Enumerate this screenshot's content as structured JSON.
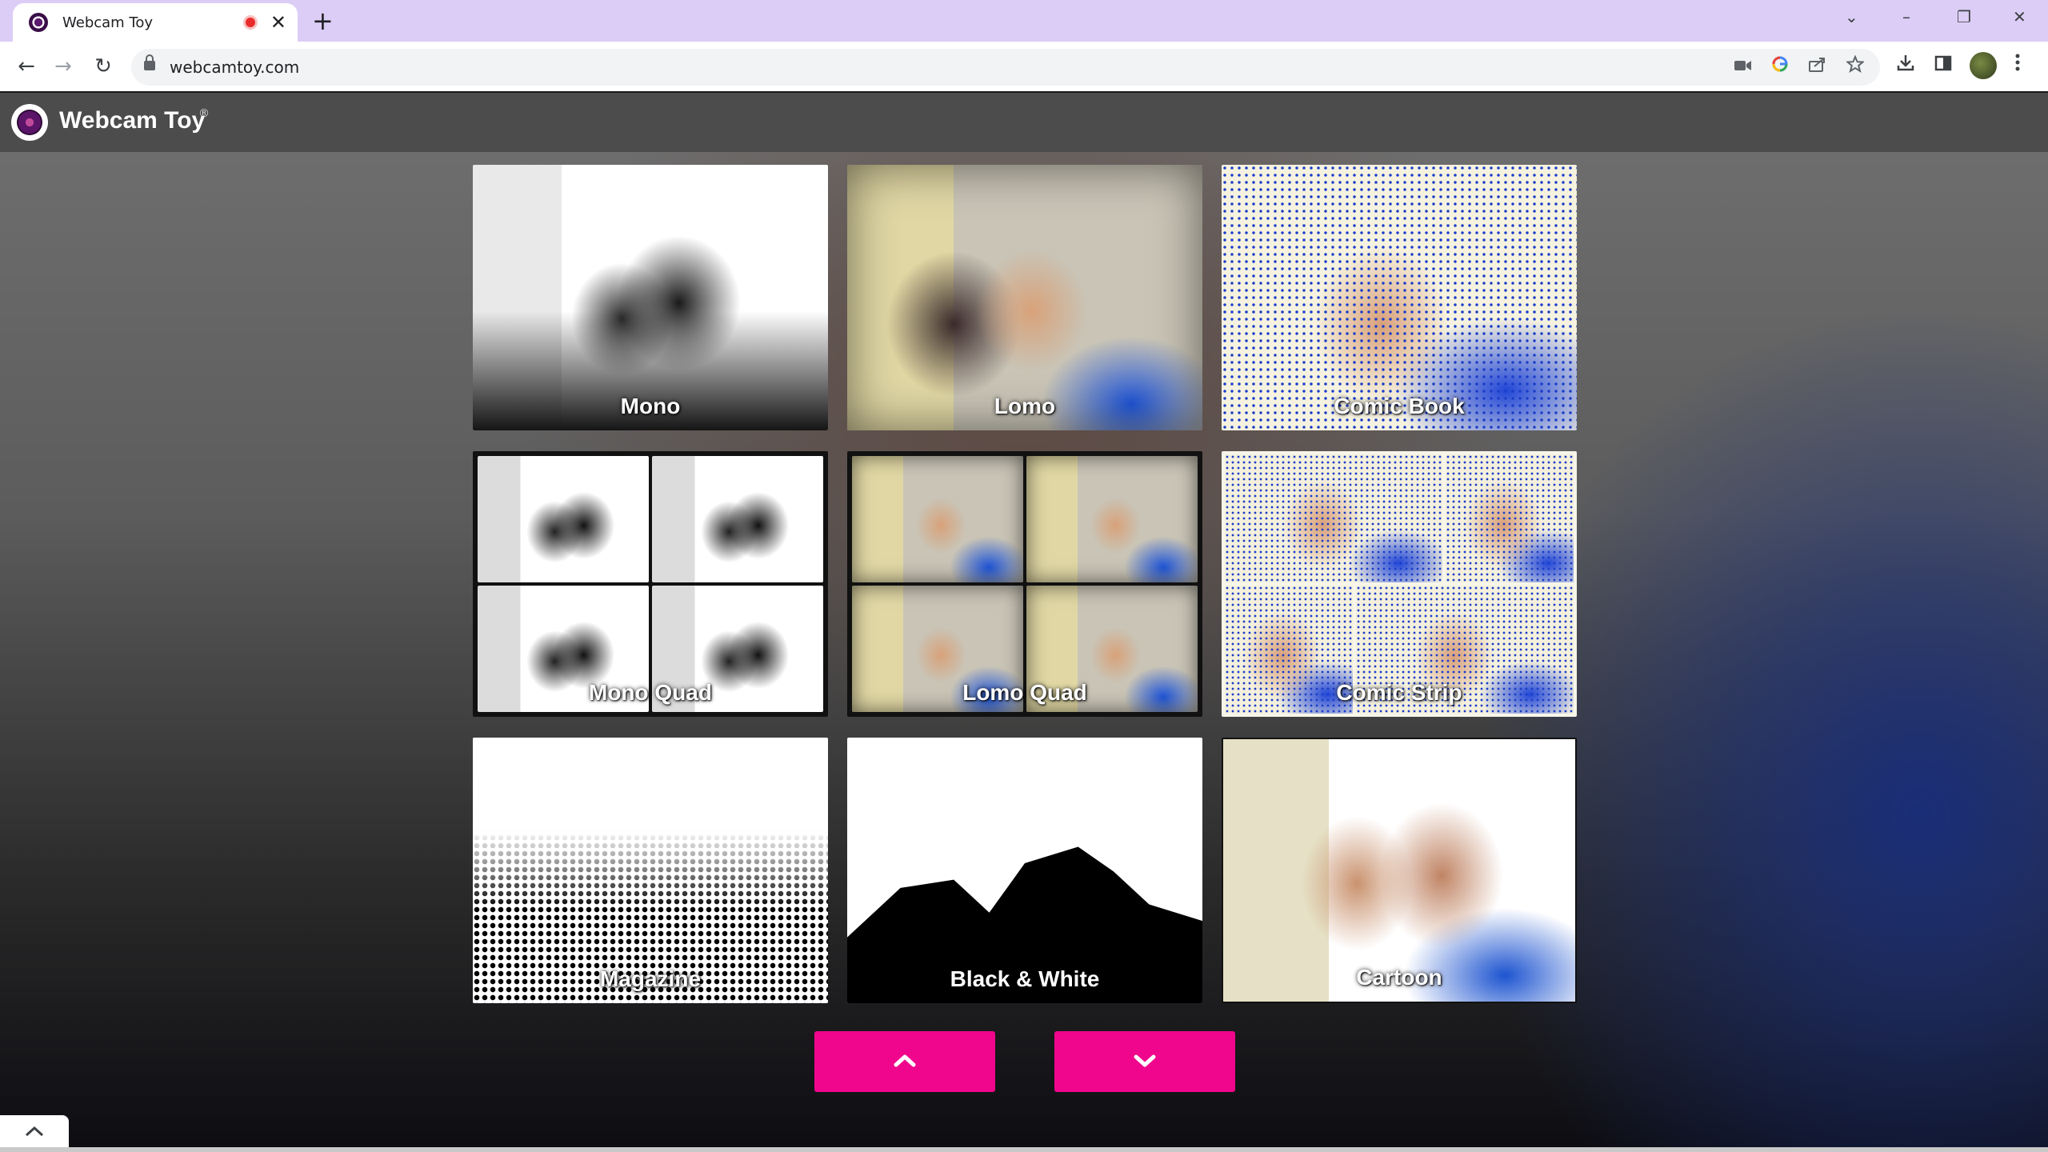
{
  "browser": {
    "tab_title": "Webcam Toy",
    "tab_close": "✕",
    "new_tab": "+",
    "url": "webcamtoy.com",
    "window_controls": {
      "tab_search": "⌄",
      "minimize": "–",
      "restore": "❐",
      "close": "✕"
    },
    "nav": {
      "back": "←",
      "forward": "→",
      "reload": "↻"
    },
    "icons": [
      "camera-icon",
      "google-icon",
      "share-icon",
      "star-icon",
      "download-icon",
      "side-panel-icon",
      "profile-avatar",
      "menu-icon"
    ],
    "recording_color": "#ea2b2b"
  },
  "site": {
    "logo_text": "Webcam Toy",
    "logo_mark": "®",
    "accent_color": "#f0068c",
    "effects": [
      {
        "label": "Mono"
      },
      {
        "label": "Lomo"
      },
      {
        "label": "Comic Book"
      },
      {
        "label": "Mono Quad"
      },
      {
        "label": "Lomo Quad"
      },
      {
        "label": "Comic Strip"
      },
      {
        "label": "Magazine"
      },
      {
        "label": "Black & White"
      },
      {
        "label": "Cartoon"
      }
    ],
    "buttons": {
      "up": "previous-page",
      "down": "next-page"
    }
  }
}
